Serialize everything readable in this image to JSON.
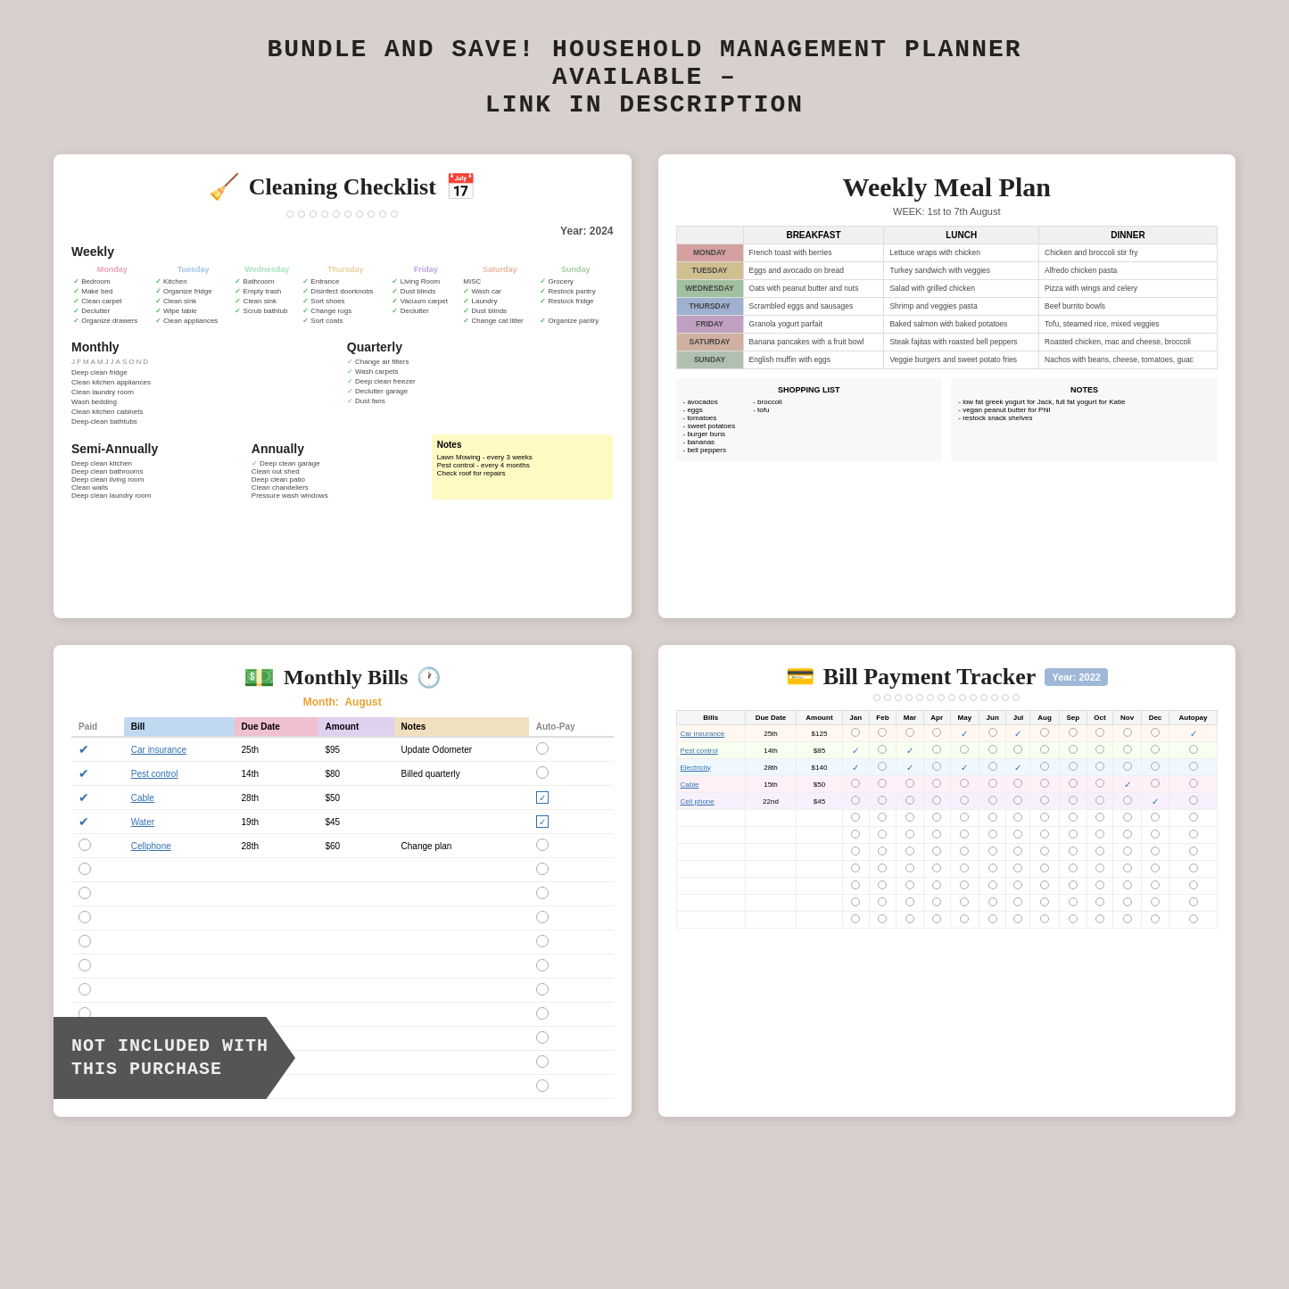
{
  "header": {
    "line1": "BUNDLE AND SAVE! HOUSEHOLD MANAGEMENT PLANNER AVAILABLE –",
    "line2": "LINK IN DESCRIPTION"
  },
  "cleaning": {
    "title": "Cleaning Checklist",
    "year_label": "Year: 2024",
    "weekly_label": "Weekly",
    "monthly_label": "Monthly",
    "quarterly_label": "Quarterly",
    "semi_label": "Semi-Annually",
    "annually_label": "Annually",
    "notes_label": "Notes",
    "days": [
      "Monday",
      "Tuesday",
      "Wednesday",
      "Thursday",
      "Friday",
      "Saturday",
      "Sunday"
    ],
    "notes_items": [
      "Lawn Mowing - every 3 weeks",
      "Pest control - every 4 months",
      "Check roof for repairs"
    ]
  },
  "meal": {
    "title": "Weekly Meal Plan",
    "week": "WEEK: 1st to 7th August",
    "col_breakfast": "BREAKFAST",
    "col_lunch": "LUNCH",
    "col_dinner": "DINNER",
    "days": [
      {
        "day": "MONDAY",
        "breakfast": "French toast with berries",
        "lunch": "Lettuce wraps with chicken",
        "dinner": "Chicken and broccoli stir fry"
      },
      {
        "day": "TUESDAY",
        "breakfast": "Eggs and avocado on bread",
        "lunch": "Turkey sandwich with veggies",
        "dinner": "Alfredo chicken pasta"
      },
      {
        "day": "WEDNESDAY",
        "breakfast": "Oats with peanut butter and nuts",
        "lunch": "Salad with grilled chicken",
        "dinner": "Pizza with wings and celery"
      },
      {
        "day": "THURSDAY",
        "breakfast": "Scrambled eggs and sausages",
        "lunch": "Shrimp and veggies pasta",
        "dinner": "Beef burrito bowls"
      },
      {
        "day": "FRIDAY",
        "breakfast": "Granola yogurt parfait",
        "lunch": "Baked salmon with baked potatoes",
        "dinner": "Tofu, steamed rice, mixed veggies"
      },
      {
        "day": "SATURDAY",
        "breakfast": "Banana pancakes with a fruit bowl",
        "lunch": "Steak fajitas with roasted bell peppers",
        "dinner": "Roasted chicken, mac and cheese, broccoli"
      },
      {
        "day": "SUNDAY",
        "breakfast": "English muffin with eggs",
        "lunch": "Veggie burgers and sweet potato fries",
        "dinner": "Nachos with beans, cheese, tomatoes, guac"
      }
    ],
    "shopping_list_title": "SHOPPING LIST",
    "shopping_items_col1": [
      "- avocados",
      "- eggs",
      "- tomatoes",
      "- sweet potatoes",
      "- burger buns",
      "-bananas",
      "- bell peppers"
    ],
    "shopping_items_col2": [
      "- broccoli",
      "- tofu"
    ],
    "notes_title": "NOTES",
    "notes_items": [
      "- low fat greek yogurt for Jack, full fat yogurt for Katie",
      "- vegan peanut butter for Phil",
      "- restock snack shelves"
    ]
  },
  "bills": {
    "title": "Monthly Bills",
    "month_label": "Month:",
    "month_value": "August",
    "col_paid": "Paid",
    "col_bill": "Bill",
    "col_due": "Due Date",
    "col_amount": "Amount",
    "col_notes": "Notes",
    "col_auto": "Auto-Pay",
    "items": [
      {
        "paid": true,
        "bill": "Car insurance",
        "due": "25th",
        "amount": "$95",
        "notes": "Update Odometer",
        "auto": false
      },
      {
        "paid": true,
        "bill": "Pest control",
        "due": "14th",
        "amount": "$80",
        "notes": "Billed quarterly",
        "auto": false
      },
      {
        "paid": true,
        "bill": "Cable",
        "due": "28th",
        "amount": "$50",
        "notes": "",
        "auto": true
      },
      {
        "paid": true,
        "bill": "Water",
        "due": "19th",
        "amount": "$45",
        "notes": "",
        "auto": true
      },
      {
        "paid": false,
        "bill": "Cellphone",
        "due": "28th",
        "amount": "$60",
        "notes": "Change plan",
        "auto": false
      }
    ],
    "not_included_line1": "NOT INCLUDED WITH",
    "not_included_line2": "THIS PURCHASE"
  },
  "tracker": {
    "title": "Bill Payment Tracker",
    "year_label": "Year:",
    "year_value": "2022",
    "col_bills": "Bills",
    "col_due": "Due Date",
    "col_amount": "Amount",
    "months": [
      "Jan",
      "Feb",
      "Mar",
      "Apr",
      "May",
      "Jun",
      "Jul",
      "Aug",
      "Sep",
      "Oct",
      "Nov",
      "Dec"
    ],
    "col_autopay": "Autopay",
    "items": [
      {
        "bill": "Car insurance",
        "due": "25th",
        "amount": "$125",
        "checks": [
          false,
          false,
          false,
          false,
          true,
          false,
          true,
          false,
          false,
          false,
          false,
          false
        ],
        "autopay": true
      },
      {
        "bill": "Pest control",
        "due": "14th",
        "amount": "$85",
        "checks": [
          true,
          false,
          true,
          false,
          false,
          false,
          false,
          false,
          false,
          false,
          false,
          false
        ],
        "autopay": false
      },
      {
        "bill": "Electricity",
        "due": "28th",
        "amount": "$140",
        "checks": [
          true,
          false,
          true,
          false,
          true,
          false,
          true,
          false,
          false,
          false,
          false,
          false
        ],
        "autopay": false
      },
      {
        "bill": "Cable",
        "due": "15th",
        "amount": "$50",
        "checks": [
          false,
          false,
          false,
          false,
          false,
          false,
          false,
          false,
          false,
          false,
          true,
          false
        ],
        "autopay": false
      },
      {
        "bill": "Cell phone",
        "due": "22nd",
        "amount": "$45",
        "checks": [
          false,
          false,
          false,
          false,
          false,
          false,
          false,
          false,
          false,
          false,
          false,
          true
        ],
        "autopay": false
      }
    ]
  }
}
